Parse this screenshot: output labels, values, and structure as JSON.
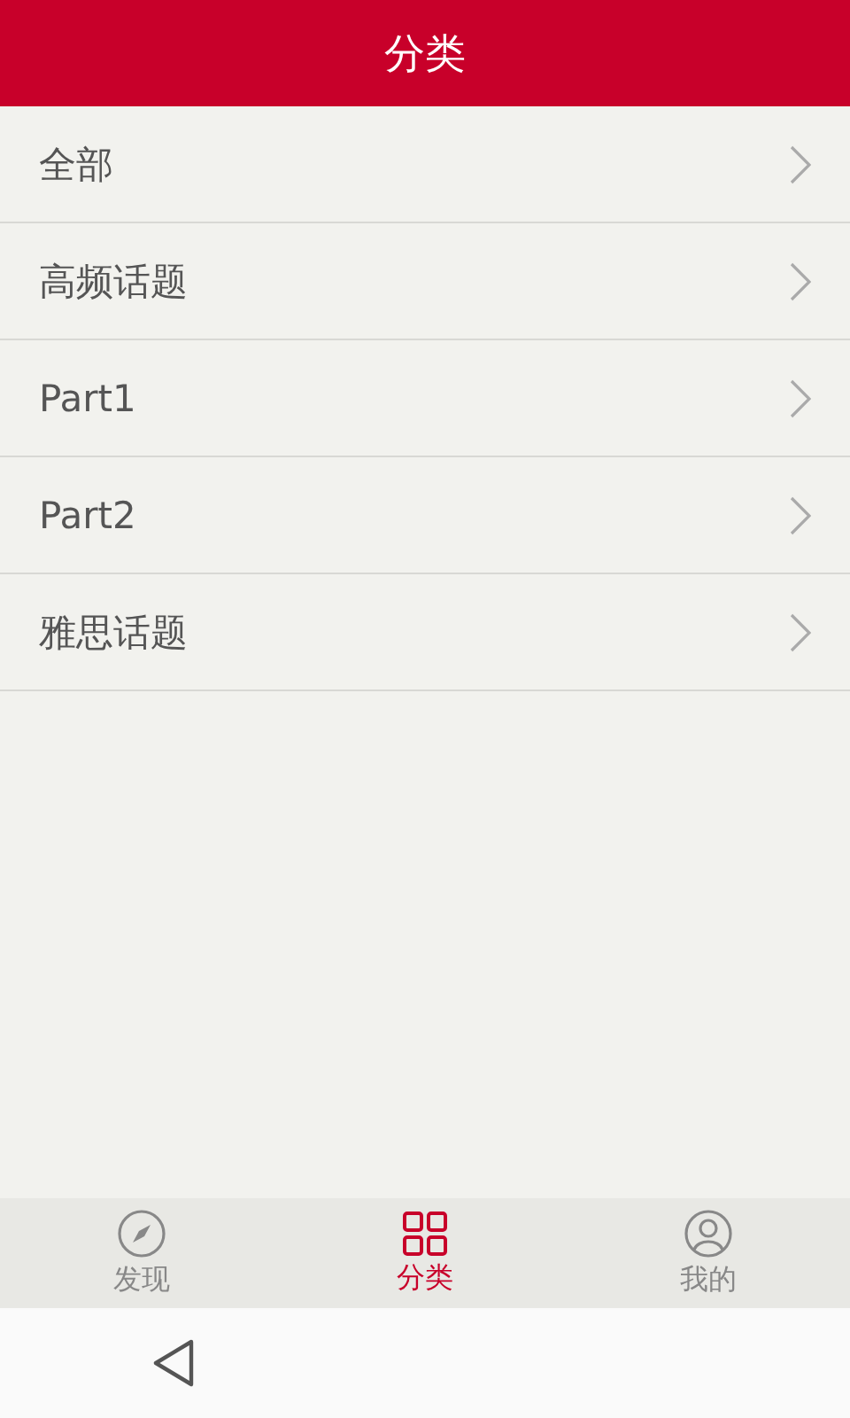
{
  "header": {
    "title": "分类"
  },
  "categories": [
    {
      "label": "全部"
    },
    {
      "label": "高频话题"
    },
    {
      "label": "Part1"
    },
    {
      "label": "Part2"
    },
    {
      "label": "雅思话题"
    }
  ],
  "tabs": [
    {
      "label": "发现",
      "selected": false
    },
    {
      "label": "分类",
      "selected": true
    },
    {
      "label": "我的",
      "selected": false
    }
  ]
}
